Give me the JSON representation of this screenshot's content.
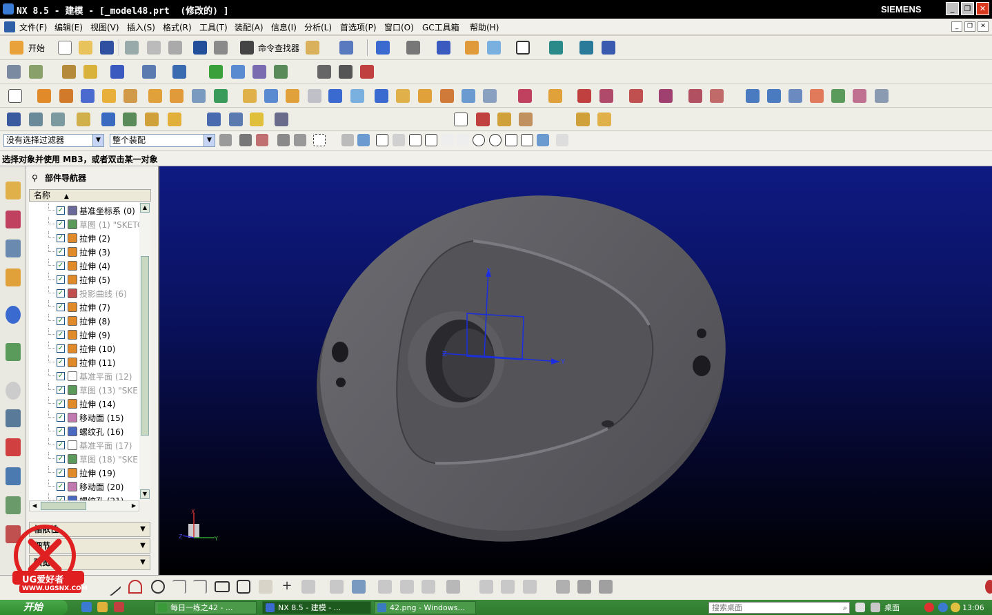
{
  "window": {
    "title": "NX 8.5 - 建模 - [_model48.prt  (修改的) ]",
    "brand": "SIEMENS",
    "controls": [
      "_",
      "❐",
      "✕"
    ]
  },
  "menu": [
    "文件(F)",
    "编辑(E)",
    "视图(V)",
    "插入(S)",
    "格式(R)",
    "工具(T)",
    "装配(A)",
    "信息(I)",
    "分析(L)",
    "首选项(P)",
    "窗口(O)",
    "GC工具箱",
    "帮助(H)"
  ],
  "toolbar": {
    "start_label": "开始",
    "command_finder_label": "命令查找器"
  },
  "selection": {
    "filter": "没有选择过滤器",
    "scope": "整个装配"
  },
  "cue_line": "选择对象并使用 MB3，或者双击某一对象",
  "navigator": {
    "title": "部件导航器",
    "column_name": "名称",
    "features": [
      {
        "label": "基准坐标系 (0)",
        "dim": false,
        "icon": "datum-csys-icon",
        "color": "#6a6a9a"
      },
      {
        "label": "草图 (1) \"SKETC",
        "dim": true,
        "icon": "sketch-icon",
        "color": "#5b9a5b"
      },
      {
        "label": "拉伸 (2)",
        "dim": false,
        "icon": "extrude-icon",
        "color": "#e08a2a"
      },
      {
        "label": "拉伸 (3)",
        "dim": false,
        "icon": "extrude-icon",
        "color": "#e08a2a"
      },
      {
        "label": "拉伸 (4)",
        "dim": false,
        "icon": "extrude-icon",
        "color": "#e08a2a"
      },
      {
        "label": "拉伸 (5)",
        "dim": false,
        "icon": "extrude-icon",
        "color": "#e08a2a"
      },
      {
        "label": "投影曲线 (6)",
        "dim": true,
        "icon": "projected-curve-icon",
        "color": "#c05050"
      },
      {
        "label": "拉伸 (7)",
        "dim": false,
        "icon": "extrude-icon",
        "color": "#e08a2a"
      },
      {
        "label": "拉伸 (8)",
        "dim": false,
        "icon": "extrude-icon",
        "color": "#e08a2a"
      },
      {
        "label": "拉伸 (9)",
        "dim": false,
        "icon": "extrude-icon",
        "color": "#e08a2a"
      },
      {
        "label": "拉伸 (10)",
        "dim": false,
        "icon": "extrude-icon",
        "color": "#e08a2a"
      },
      {
        "label": "拉伸 (11)",
        "dim": false,
        "icon": "extrude-icon",
        "color": "#e08a2a"
      },
      {
        "label": "基准平面 (12)",
        "dim": true,
        "icon": "datum-plane-icon",
        "color": "#ffffff"
      },
      {
        "label": "草图 (13) \"SKE",
        "dim": true,
        "icon": "sketch-icon",
        "color": "#5b9a5b"
      },
      {
        "label": "拉伸 (14)",
        "dim": false,
        "icon": "extrude-icon",
        "color": "#e08a2a"
      },
      {
        "label": "移动面 (15)",
        "dim": false,
        "icon": "move-face-icon",
        "color": "#c07ab0"
      },
      {
        "label": "螺纹孔 (16)",
        "dim": false,
        "icon": "threaded-hole-icon",
        "color": "#4a6ac0"
      },
      {
        "label": "基准平面 (17)",
        "dim": true,
        "icon": "datum-plane-icon",
        "color": "#ffffff"
      },
      {
        "label": "草图 (18) \"SKE",
        "dim": true,
        "icon": "sketch-icon",
        "color": "#5b9a5b"
      },
      {
        "label": "拉伸 (19)",
        "dim": false,
        "icon": "extrude-icon",
        "color": "#e08a2a"
      },
      {
        "label": "移动面 (20)",
        "dim": false,
        "icon": "move-face-icon",
        "color": "#c07ab0"
      },
      {
        "label": "螺纹孔 (21)",
        "dim": false,
        "icon": "threaded-hole-icon",
        "color": "#4a6ac0"
      }
    ],
    "panels": [
      "相依性",
      "细节",
      "预览"
    ]
  },
  "viewport": {
    "background_top": "#0f1a82",
    "background_bottom": "#000000",
    "part_color": "#5a5a5e",
    "wcs_axes": [
      "X",
      "Y",
      "Z"
    ],
    "triad_axes": [
      "X",
      "Y",
      "Z"
    ]
  },
  "watermark": {
    "text": "UG爱好者",
    "url": "WWW.UGSNX.COM"
  },
  "taskbar": {
    "start": "开始",
    "tasks": [
      "每日一练之42 - ...",
      "NX 8.5 - 建模 - ...",
      "42.png - Windows..."
    ],
    "search_placeholder": "搜索桌面",
    "tray_label": "桌面",
    "clock": "13:06"
  }
}
